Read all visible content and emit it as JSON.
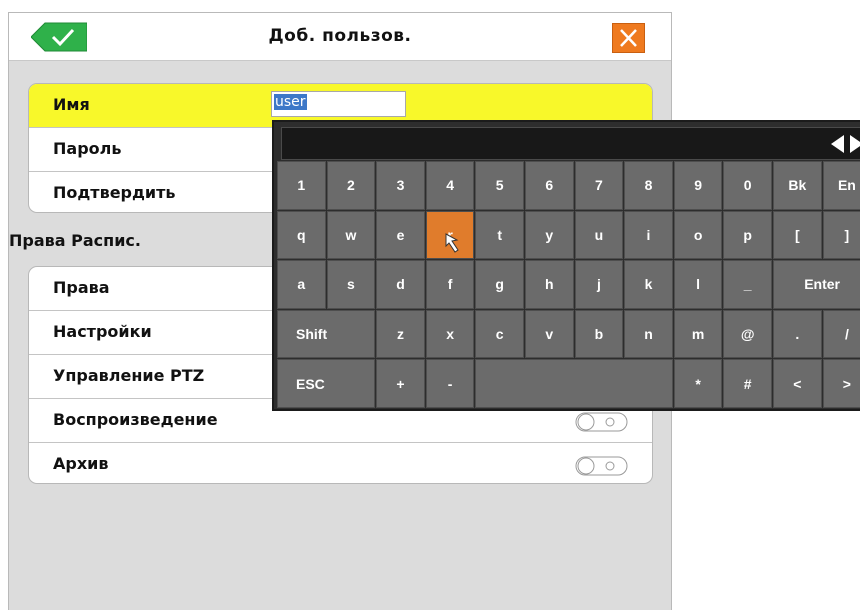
{
  "dialog": {
    "title": "Доб. пользов.",
    "confirm_icon": "checkmark-icon",
    "close_icon": "close-icon",
    "accent_color": "#ef7a1f",
    "confirm_color": "#2fb14a"
  },
  "user_fields": [
    {
      "label": "Имя",
      "highlighted": true
    },
    {
      "label": "Пароль"
    },
    {
      "label": "Подтвердить"
    }
  ],
  "name_input": {
    "value": "user"
  },
  "section_title": "Права Распис.",
  "permissions": [
    {
      "label": "Права",
      "toggle": "hidden-by-keyboard"
    },
    {
      "label": "Настройки",
      "toggle": "hidden-by-keyboard"
    },
    {
      "label": "Управление PTZ",
      "toggle": "hidden-by-keyboard"
    },
    {
      "label": "Воспроизведение",
      "toggle": "off"
    },
    {
      "label": "Архив",
      "toggle": "off"
    }
  ],
  "keyboard": {
    "nav_icon": "arrows-left-right-icon",
    "active_key": "r",
    "rows": [
      [
        "1",
        "2",
        "3",
        "4",
        "5",
        "6",
        "7",
        "8",
        "9",
        "0",
        "Bk",
        "En"
      ],
      [
        "q",
        "w",
        "e",
        "r",
        "t",
        "y",
        "u",
        "i",
        "o",
        "p",
        "[",
        "]"
      ],
      [
        "a",
        "s",
        "d",
        "f",
        "g",
        "h",
        "j",
        "k",
        "l",
        "_",
        "Enter"
      ],
      [
        "Shift",
        "z",
        "x",
        "c",
        "v",
        "b",
        "n",
        "m",
        "@",
        ".",
        "/"
      ],
      [
        "ESC",
        "+",
        "-",
        "*",
        "#",
        "<",
        ">"
      ]
    ]
  }
}
